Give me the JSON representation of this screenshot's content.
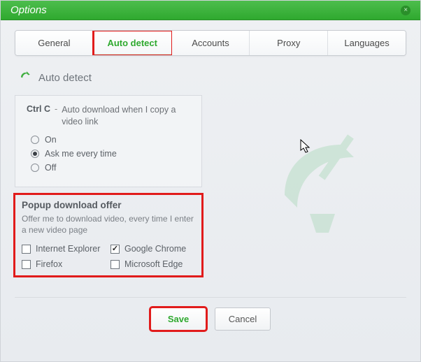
{
  "window": {
    "title": "Options"
  },
  "tabs": {
    "general": "General",
    "auto_detect": "Auto detect",
    "accounts": "Accounts",
    "proxy": "Proxy",
    "languages": "Languages",
    "active": "auto_detect"
  },
  "section": {
    "title": "Auto detect"
  },
  "ctrlc": {
    "key": "Ctrl C",
    "dash": "-",
    "desc": "Auto download when I copy a video link",
    "options": {
      "on": "On",
      "ask": "Ask me every time",
      "off": "Off"
    },
    "selected": "ask"
  },
  "popup": {
    "title": "Popup download offer",
    "desc": "Offer me to download video, every time I enter a new video page",
    "browsers": {
      "ie": {
        "label": "Internet Explorer",
        "checked": false
      },
      "chrome": {
        "label": "Google Chrome",
        "checked": true
      },
      "firefox": {
        "label": "Firefox",
        "checked": false
      },
      "edge": {
        "label": "Microsoft Edge",
        "checked": false
      }
    }
  },
  "buttons": {
    "save": "Save",
    "cancel": "Cancel"
  }
}
